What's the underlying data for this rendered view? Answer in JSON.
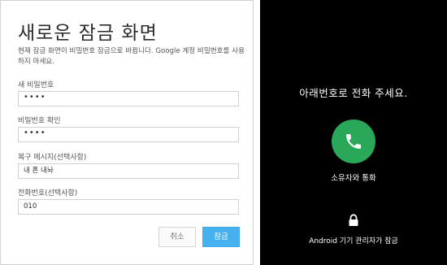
{
  "dialog": {
    "title": "새로운 잠금 화면",
    "description": "현재 잠금 화면이 비밀번호 잠금으로 바뀝니다. Google 계정 비밀번호를 사용하지 마세요.",
    "fields": [
      {
        "label": "새 비밀번호",
        "value": "••••"
      },
      {
        "label": "비밀번호 확인",
        "value": "••••"
      },
      {
        "label": "복구 메시지(선택사항)",
        "value": "내 폰 내놔"
      },
      {
        "label": "전화번호(선택사항)",
        "value": "010"
      }
    ],
    "cancel_label": "취소",
    "lock_label": "잠금"
  },
  "lockscreen": {
    "message": "아래번호로 전화 주세요.",
    "call_label": "소유자와 통화",
    "owner_text": "Android 기기 관리자가 잠금"
  },
  "colors": {
    "accent": "#45b1ee",
    "call_green": "#28a858",
    "lock_bg": "#000000"
  },
  "icons": [
    "phone-icon",
    "lock-icon"
  ]
}
